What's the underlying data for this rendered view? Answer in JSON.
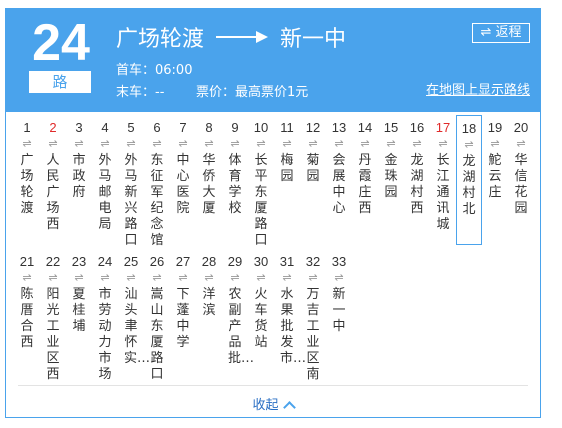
{
  "route": {
    "number": "24",
    "suffix": "路",
    "origin": "广场轮渡",
    "destination": "新一中"
  },
  "schedule": {
    "first_bus": "首车：06:00",
    "last_bus": "末车：--",
    "fare": "票价：最高票价1元"
  },
  "actions": {
    "reverse": "返程",
    "show_on_map": "在地图上显示路线",
    "collapse": "收起"
  },
  "colors": {
    "accent": "#4aa3ec",
    "highlight": "#e02a2a"
  },
  "direction_glyph": "⇌",
  "stops": [
    {
      "num": "1",
      "name": "广场轮渡",
      "red": false
    },
    {
      "num": "2",
      "name": "人民广场西",
      "red": true
    },
    {
      "num": "3",
      "name": "市政府",
      "red": false
    },
    {
      "num": "4",
      "name": "外马邮电局",
      "red": false
    },
    {
      "num": "5",
      "name": "外马新兴路口",
      "red": false
    },
    {
      "num": "6",
      "name": "东征军纪念馆",
      "red": false
    },
    {
      "num": "7",
      "name": "中心医院",
      "red": false
    },
    {
      "num": "8",
      "name": "华侨大厦",
      "red": false
    },
    {
      "num": "9",
      "name": "体育学校",
      "red": false
    },
    {
      "num": "10",
      "name": "长平东厦路口",
      "red": false
    },
    {
      "num": "11",
      "name": "梅园",
      "red": false
    },
    {
      "num": "12",
      "name": "菊园",
      "red": false
    },
    {
      "num": "13",
      "name": "会展中心",
      "red": false
    },
    {
      "num": "14",
      "name": "丹霞庄西",
      "red": false
    },
    {
      "num": "15",
      "name": "金珠园",
      "red": false
    },
    {
      "num": "16",
      "name": "龙湖村西",
      "red": false
    },
    {
      "num": "17",
      "name": "长江通讯城",
      "red": true
    },
    {
      "num": "18",
      "name": "龙湖村北",
      "red": false,
      "current": true
    },
    {
      "num": "19",
      "name": "鮀云庄",
      "red": false
    },
    {
      "num": "20",
      "name": "华信花园",
      "red": false
    },
    {
      "num": "21",
      "name": "陈厝合西",
      "red": false
    },
    {
      "num": "22",
      "name": "阳光工业区西",
      "red": false
    },
    {
      "num": "23",
      "name": "夏桂埔",
      "red": false
    },
    {
      "num": "24",
      "name": "市劳动力市场",
      "red": false
    },
    {
      "num": "25",
      "name": "汕头聿怀实…",
      "red": false
    },
    {
      "num": "26",
      "name": "嵩山东厦路口",
      "red": false
    },
    {
      "num": "27",
      "name": "下蓬中学",
      "red": false
    },
    {
      "num": "28",
      "name": "洋滨",
      "red": false
    },
    {
      "num": "29",
      "name": "农副产品批…",
      "red": false
    },
    {
      "num": "30",
      "name": "火车货站",
      "red": false
    },
    {
      "num": "31",
      "name": "水果批发市…",
      "red": false
    },
    {
      "num": "32",
      "name": "万吉工业区南",
      "red": false
    },
    {
      "num": "33",
      "name": "新一中",
      "red": false
    }
  ]
}
